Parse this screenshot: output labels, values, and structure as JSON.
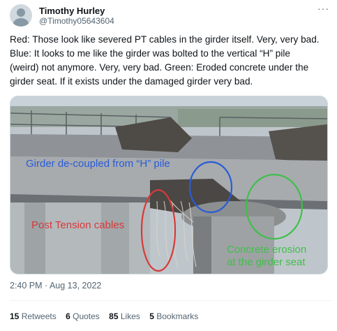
{
  "author": {
    "name": "Timothy Hurley",
    "handle": "@Timothy05643604",
    "more_glyph": "···"
  },
  "tweet": {
    "lines": [
      "Red: Those look like severed PT cables in the girder itself. Very, very bad.",
      "Blue: It looks to me like the girder was bolted to the vertical “H” pile",
      "(weird) not anymore. Very, very bad. Green: Eroded concrete under the",
      "girder seat. If it exists under the damaged girder very bad."
    ]
  },
  "media": {
    "annotations": {
      "blue": "Girder de-coupled from “H” pile",
      "red": "Post Tension cables",
      "green_line1": "Concrete erosion",
      "green_line2": "at the girder seat"
    },
    "colors": {
      "blue": "#2a5bd7",
      "red": "#d63a3a",
      "green": "#3fbf4a"
    }
  },
  "timestamp": "2:40 PM · Aug 13, 2022",
  "stats": [
    {
      "count": "15",
      "label": "Retweets"
    },
    {
      "count": "6",
      "label": "Quotes"
    },
    {
      "count": "85",
      "label": "Likes"
    },
    {
      "count": "5",
      "label": "Bookmarks"
    }
  ]
}
